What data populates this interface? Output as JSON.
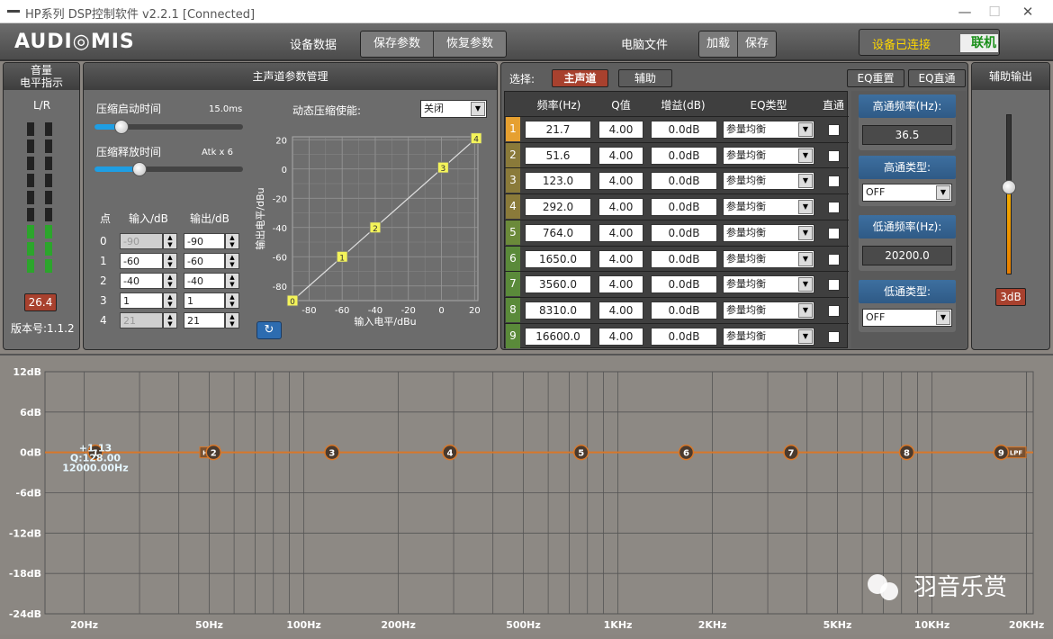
{
  "window": {
    "title": "HP系列 DSP控制软件 v2.2.1 [Connected]",
    "minimize": "—",
    "maximize": "☐",
    "close": "✕"
  },
  "header": {
    "logo": "AUDI◎MIS",
    "device_data_label": "设备数据",
    "save_params": "保存参数",
    "restore_params": "恢复参数",
    "pc_file_label": "电脑文件",
    "load": "加载",
    "save": "保存",
    "connected_status": "设备已连接",
    "online": "联机"
  },
  "level": {
    "title_line1": "音量",
    "title_line2": "电平指示",
    "lr": "L/R",
    "value": "26.4",
    "version": "版本号:1.1.2"
  },
  "compressor": {
    "title": "主声道参数管理",
    "attack_label": "压缩启动时间",
    "attack_value": "15.0ms",
    "release_label": "压缩释放时间",
    "release_value": "Atk x 6",
    "attack_fraction": 0.18,
    "release_fraction": 0.3,
    "table_headers": [
      "点",
      "输入/dB",
      "输出/dB"
    ],
    "points": [
      {
        "idx": "0",
        "input": "-90",
        "output": "-90",
        "input_disabled": true
      },
      {
        "idx": "1",
        "input": "-60",
        "output": "-60",
        "input_disabled": false
      },
      {
        "idx": "2",
        "input": "-40",
        "output": "-40",
        "input_disabled": false
      },
      {
        "idx": "3",
        "input": "1",
        "output": "1",
        "input_disabled": false
      },
      {
        "idx": "4",
        "input": "21",
        "output": "21",
        "input_disabled": true
      }
    ],
    "dyn_enable_label": "动态压缩使能:",
    "dyn_enable_value": "关闭",
    "graph_ylabel": "输出电平/dBu",
    "graph_xlabel": "输入电平/dBu",
    "y_ticks": [
      "20",
      "0",
      "-20",
      "-40",
      "-60",
      "-80"
    ],
    "x_ticks": [
      "-80",
      "-60",
      "-40",
      "-20",
      "0",
      "20"
    ],
    "curve_points": [
      {
        "label": "0",
        "x": -90,
        "y": -90
      },
      {
        "label": "1",
        "x": -60,
        "y": -60
      },
      {
        "label": "2",
        "x": -40,
        "y": -40
      },
      {
        "label": "3",
        "x": 1,
        "y": 1
      },
      {
        "label": "4",
        "x": 21,
        "y": 21
      }
    ]
  },
  "eq": {
    "select_label": "选择:",
    "main_channel": "主声道",
    "aux": "辅助",
    "eq_reset": "EQ重置",
    "eq_bypass": "EQ直通",
    "headers": [
      "频率(Hz)",
      "Q值",
      "增益(dB)",
      "EQ类型",
      "直通"
    ],
    "bands": [
      {
        "n": "1",
        "freq": "21.7",
        "q": "4.00",
        "gain": "0.0dB",
        "type": "参量均衡",
        "color": "#e6a030"
      },
      {
        "n": "2",
        "freq": "51.6",
        "q": "4.00",
        "gain": "0.0dB",
        "type": "参量均衡",
        "color": "#8a7a3a"
      },
      {
        "n": "3",
        "freq": "123.0",
        "q": "4.00",
        "gain": "0.0dB",
        "type": "参量均衡",
        "color": "#8a7a3a"
      },
      {
        "n": "4",
        "freq": "292.0",
        "q": "4.00",
        "gain": "0.0dB",
        "type": "参量均衡",
        "color": "#8a7a3a"
      },
      {
        "n": "5",
        "freq": "764.0",
        "q": "4.00",
        "gain": "0.0dB",
        "type": "参量均衡",
        "color": "#6b8a3a"
      },
      {
        "n": "6",
        "freq": "1650.0",
        "q": "4.00",
        "gain": "0.0dB",
        "type": "参量均衡",
        "color": "#5a8a3a"
      },
      {
        "n": "7",
        "freq": "3560.0",
        "q": "4.00",
        "gain": "0.0dB",
        "type": "参量均衡",
        "color": "#5a8a3a"
      },
      {
        "n": "8",
        "freq": "8310.0",
        "q": "4.00",
        "gain": "0.0dB",
        "type": "参量均衡",
        "color": "#5a8a3a"
      },
      {
        "n": "9",
        "freq": "16600.0",
        "q": "4.00",
        "gain": "0.0dB",
        "type": "参量均衡",
        "color": "#5a8a3a"
      }
    ]
  },
  "filters": {
    "hp_freq_label": "高通频率(Hz):",
    "hp_freq": "36.5",
    "hp_type_label": "高通类型:",
    "hp_type": "OFF",
    "lp_freq_label": "低通频率(Hz):",
    "lp_freq": "20200.0",
    "lp_type_label": "低通类型:",
    "lp_type": "OFF"
  },
  "aux_out": {
    "title": "辅助输出",
    "value": "3dB",
    "fraction": 0.55
  },
  "response": {
    "y_labels": [
      "12dB",
      "6dB",
      "0dB",
      "-6dB",
      "-12dB",
      "-18dB",
      "-24dB"
    ],
    "x_labels": [
      "20Hz",
      "50Hz",
      "100Hz",
      "200Hz",
      "500Hz",
      "1KHz",
      "2KHz",
      "5KHz",
      "10KHz",
      "20KHz"
    ],
    "x_label_freqs": [
      20,
      50,
      100,
      200,
      500,
      1000,
      2000,
      5000,
      10000,
      20000
    ],
    "selected_gain": "+1.13",
    "selected_q": "Q:128.00",
    "selected_freq": "12000.00Hz",
    "hpf": "HPF",
    "lpf": "LPF",
    "curve_color": "#d8782a",
    "points": [
      {
        "n": "1",
        "freq": 21.7
      },
      {
        "n": "2",
        "freq": 51.6
      },
      {
        "n": "3",
        "freq": 123
      },
      {
        "n": "4",
        "freq": 292
      },
      {
        "n": "5",
        "freq": 764
      },
      {
        "n": "6",
        "freq": 1650
      },
      {
        "n": "7",
        "freq": 3560
      },
      {
        "n": "8",
        "freq": 8310
      },
      {
        "n": "9",
        "freq": 16600
      }
    ],
    "watermark": "羽音乐赏"
  }
}
